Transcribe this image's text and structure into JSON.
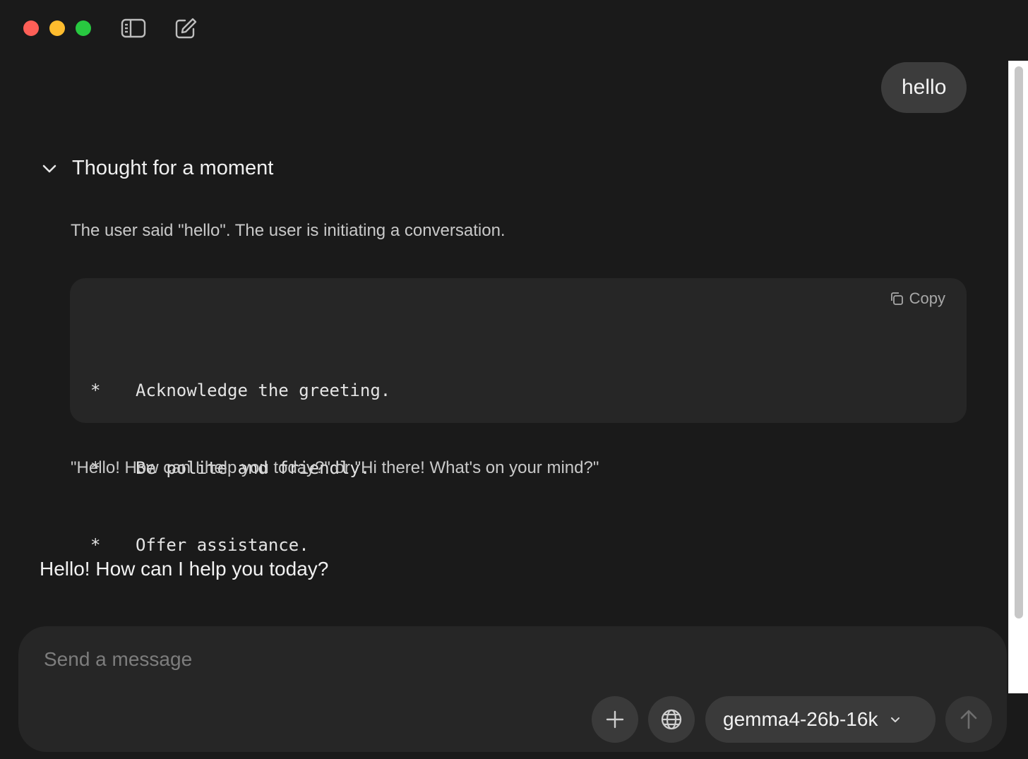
{
  "window": {
    "controls": [
      "close",
      "minimize",
      "maximize"
    ],
    "toolbar_icons": [
      "sidebar-toggle-icon",
      "new-chat-icon"
    ]
  },
  "conversation": {
    "user_message": "hello",
    "thinking": {
      "title": "Thought for a moment",
      "paragraph": "The user said \"hello\". The user is initiating a conversation.",
      "code": {
        "copy_label": "Copy",
        "lines": [
          {
            "bullet": "*",
            "text": "Acknowledge the greeting."
          },
          {
            "bullet": "*",
            "text": "Be polite and friendly."
          },
          {
            "bullet": "*",
            "text": "Offer assistance."
          }
        ]
      },
      "closing": "\"Hello! How can I help you today?\" or \"Hi there! What's on your mind?\""
    },
    "assistant_message": "Hello! How can I help you today?"
  },
  "composer": {
    "placeholder": "Send a message",
    "value": "",
    "model": "gemma4-26b-16k"
  },
  "colors": {
    "background": "#1a1a1a",
    "bubble": "#3c3c3c",
    "codeblock": "#262626",
    "close": "#fe5f57",
    "minimize": "#febc2e",
    "maximize": "#28c840"
  }
}
